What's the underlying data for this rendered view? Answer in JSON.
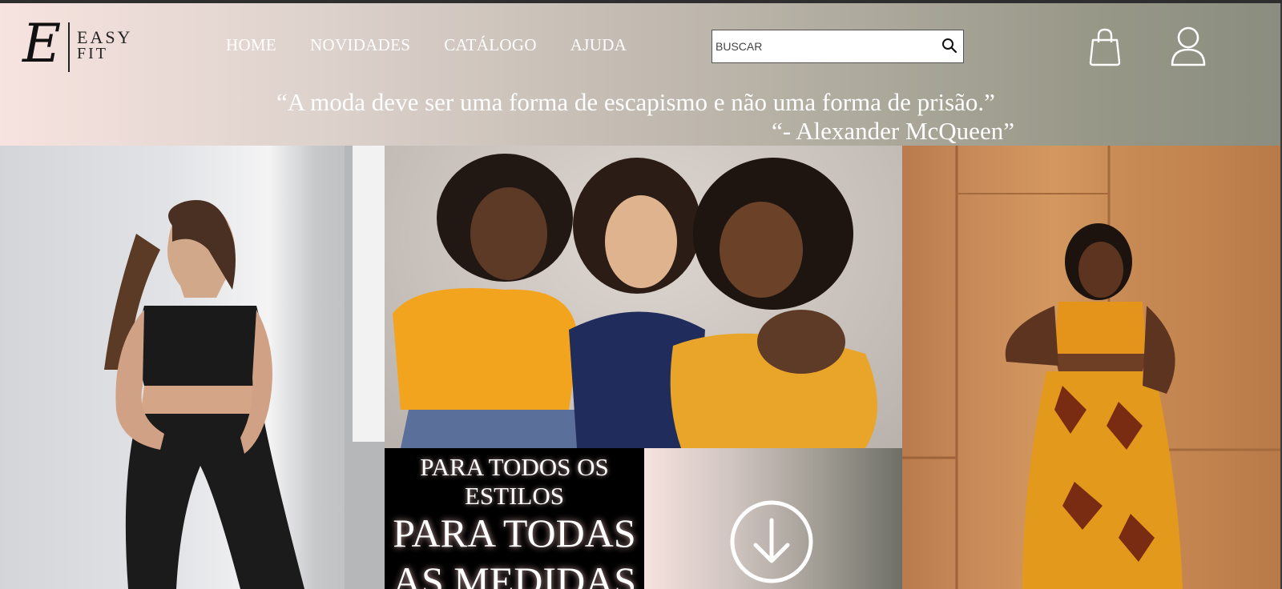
{
  "brand": {
    "initial": "E",
    "line1": "EASY",
    "line2": "FIT"
  },
  "nav": {
    "home": "HOME",
    "novidades": "NOVIDADES",
    "catalogo": "CATÁLOGO",
    "ajuda": "AJUDA"
  },
  "search": {
    "placeholder": "BUSCAR",
    "icon": "search-icon"
  },
  "header_icons": {
    "bag": "shopping-bag-icon",
    "user": "user-icon"
  },
  "quote": {
    "text": "“A moda deve ser uma forma de escapismo e não uma forma de prisão.”",
    "author": "“- Alexander McQueen”"
  },
  "banner": {
    "tagline_small": "PARA TODOS OS ESTILOS",
    "tagline_big": "PARA TODAS AS MEDIDAS",
    "scroll_icon": "arrow-down-circle-icon"
  },
  "colors": {
    "header_start": "#f7e3df",
    "header_end": "#8a8d7f",
    "text_light": "#ffffff"
  }
}
